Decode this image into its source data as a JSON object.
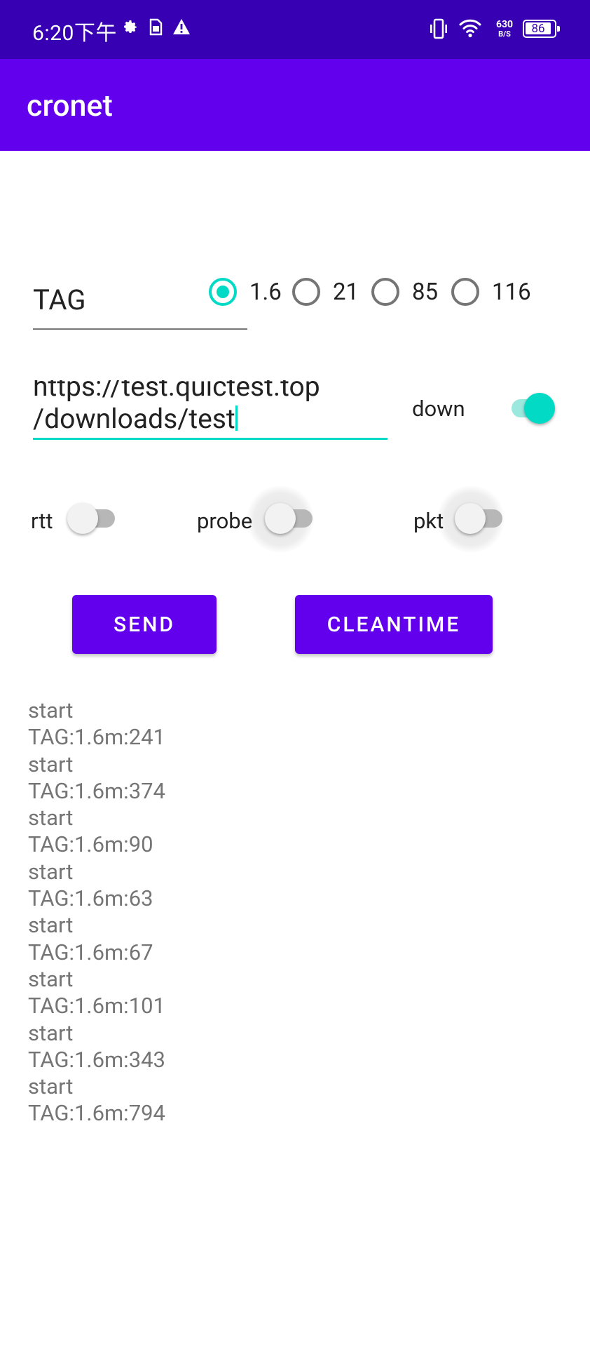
{
  "status_bar": {
    "time": "6:20下午",
    "icons": [
      "settings-icon",
      "sim-card-icon",
      "warning-icon",
      "vibrate-icon",
      "wifi-icon",
      "battery-icon"
    ],
    "network_speed_value": "630",
    "network_speed_unit": "B/S",
    "battery_level": "86"
  },
  "app_bar": {
    "title": "cronet"
  },
  "tag_input": {
    "value": "TAG"
  },
  "version_radios": [
    {
      "label": "1.6",
      "checked": true
    },
    {
      "label": "21",
      "checked": false
    },
    {
      "label": "85",
      "checked": false
    },
    {
      "label": "116",
      "checked": false
    }
  ],
  "url_input": {
    "line1": "https://test.quictest.top",
    "line2": "/downloads/test"
  },
  "toggles": {
    "down": {
      "label": "down",
      "on": true
    },
    "rtt": {
      "label": "rtt",
      "on": false
    },
    "probe": {
      "label": "probe",
      "on": false
    },
    "pkt": {
      "label": "pkt",
      "on": false
    }
  },
  "buttons": {
    "send": "SEND",
    "cleantime": "CLEANTIME"
  },
  "log_lines": [
    "start",
    "TAG:1.6m:241",
    "start",
    "TAG:1.6m:374",
    "start",
    "TAG:1.6m:90",
    "start",
    "TAG:1.6m:63",
    "start",
    "TAG:1.6m:67",
    "start",
    "TAG:1.6m:101",
    "start",
    "TAG:1.6m:343",
    "start",
    "TAG:1.6m:794"
  ],
  "colors": {
    "status_bar": "#3700b3",
    "app_bar": "#6200ee",
    "accent": "#03dac5",
    "button": "#6200ee",
    "log_text": "#757575"
  }
}
